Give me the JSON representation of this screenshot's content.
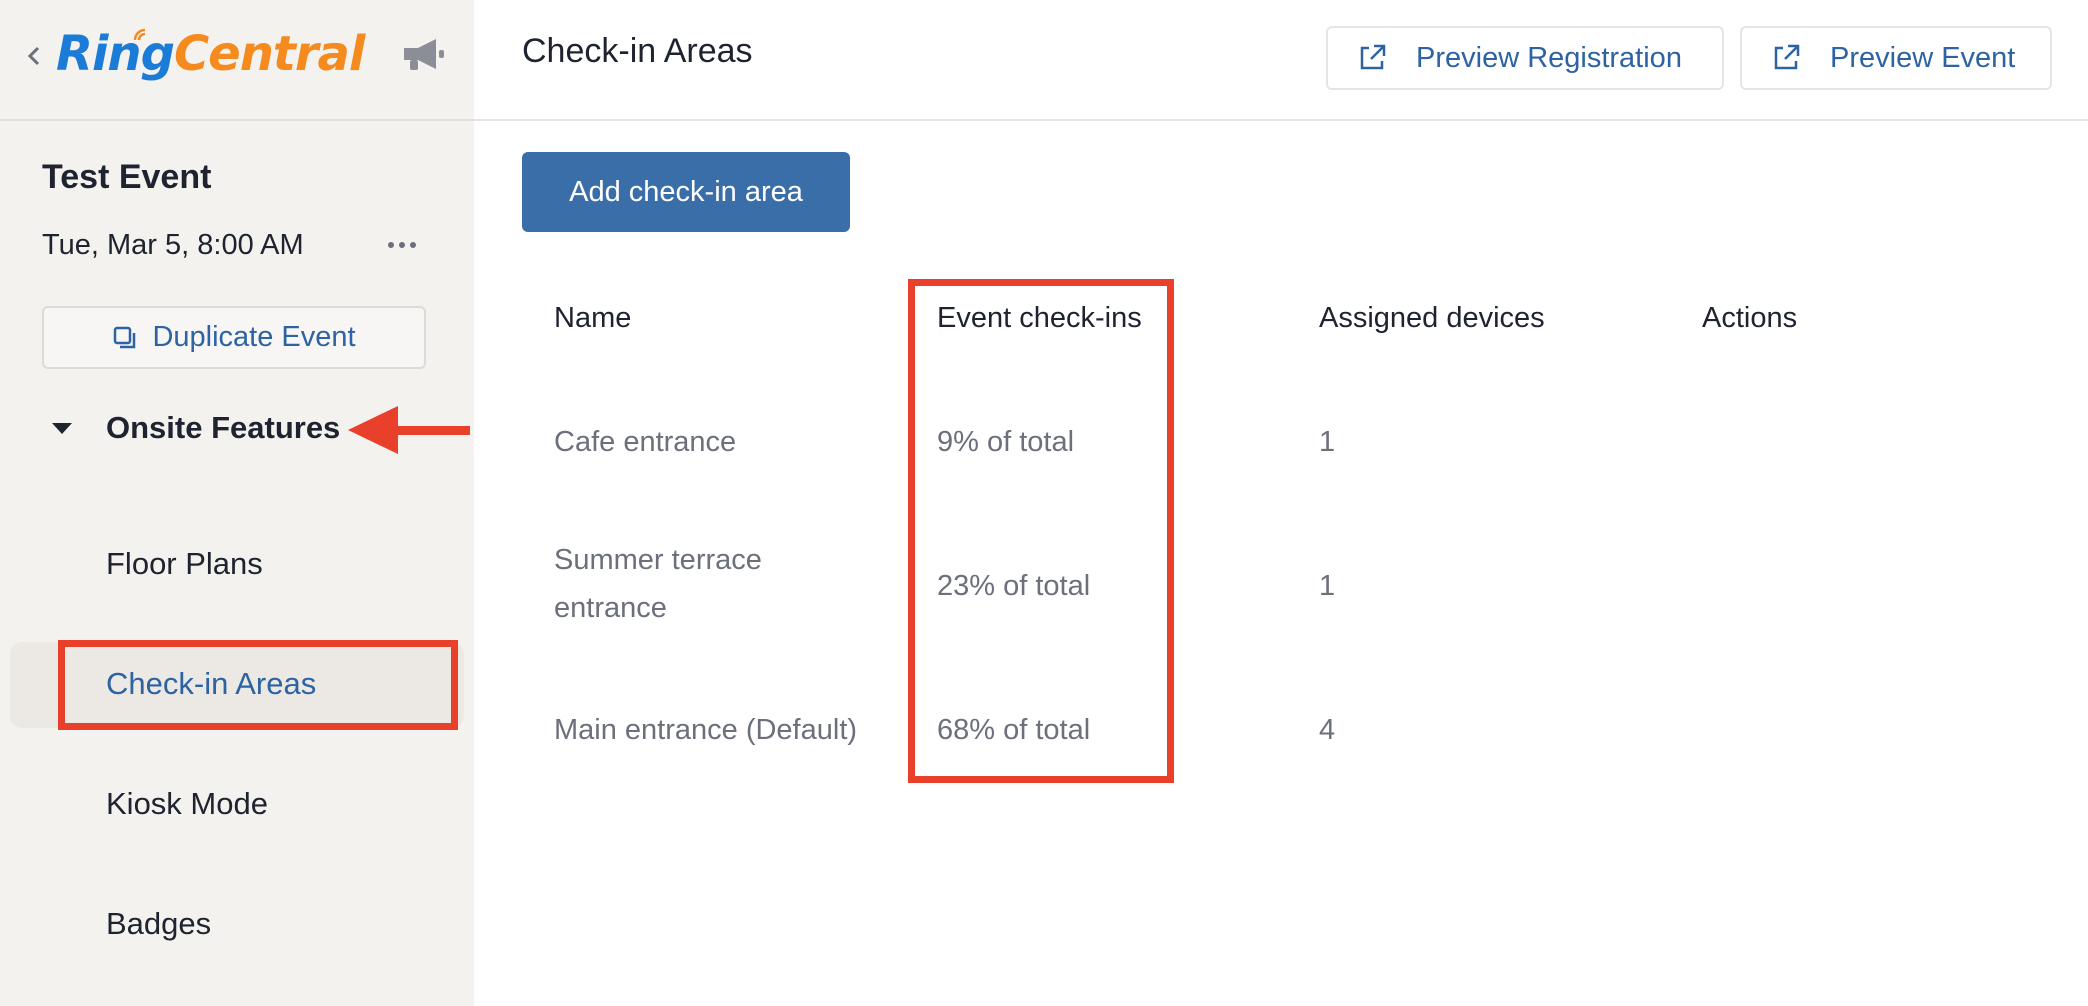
{
  "sidebar": {
    "logo": {
      "part1": "Ring",
      "part2": "Central"
    },
    "event_title": "Test Event",
    "event_date": "Tue, Mar 5, 8:00 AM",
    "duplicate_label": "Duplicate Event",
    "section_label": "Onsite Features",
    "items": [
      {
        "label": "Floor Plans"
      },
      {
        "label": "Check-in Areas",
        "active": true
      },
      {
        "label": "Kiosk Mode"
      },
      {
        "label": "Badges"
      }
    ]
  },
  "header": {
    "title": "Check-in Areas",
    "preview_registration": "Preview Registration",
    "preview_event": "Preview Event"
  },
  "main": {
    "add_button": "Add check-in area",
    "table": {
      "columns": [
        "Name",
        "Event check-ins",
        "Assigned devices",
        "Actions"
      ],
      "rows": [
        {
          "name": "Cafe entrance",
          "checkins": "9% of total",
          "devices": "1"
        },
        {
          "name_line1": "Summer terrace",
          "name_line2": "entrance",
          "checkins": "23% of total",
          "devices": "1"
        },
        {
          "name": "Main entrance (Default)",
          "checkins": "68% of total",
          "devices": "4"
        }
      ]
    }
  },
  "colors": {
    "accent": "#2d63a3",
    "primary_button": "#3a6ea8",
    "annotation_red": "#e8402a",
    "sidebar_bg": "#f4f2ef",
    "logo_blue": "#1a7cd6",
    "logo_orange": "#f58a1f"
  },
  "icons": [
    "back-chevron-icon",
    "megaphone-icon",
    "more-horizontal-icon",
    "duplicate-icon",
    "caret-down-icon",
    "external-link-icon"
  ]
}
